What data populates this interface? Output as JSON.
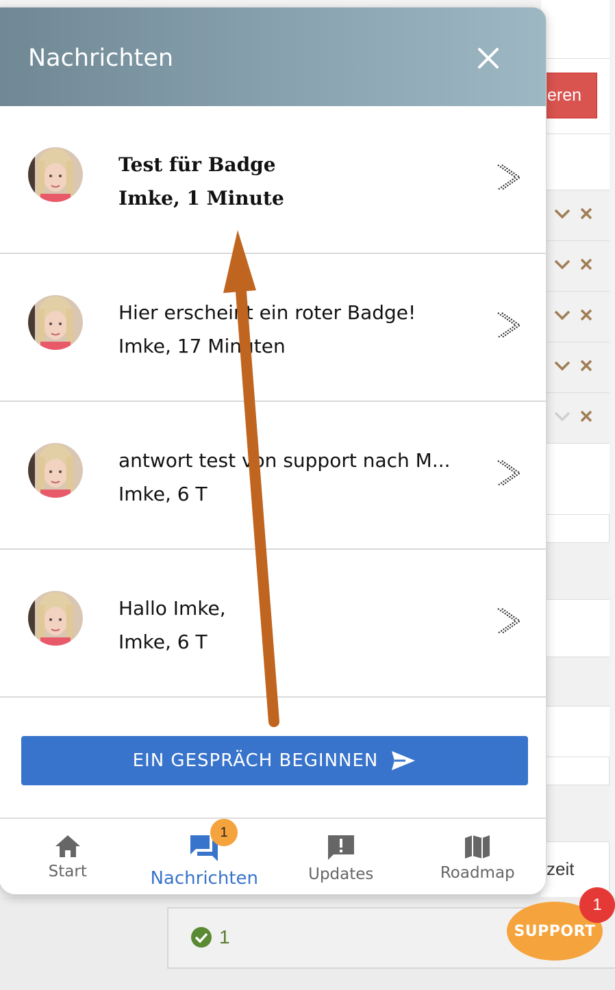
{
  "background": {
    "button_partial": "eren",
    "column_partial": "zeit",
    "status_count": "1"
  },
  "panel": {
    "title": "Nachrichten",
    "conversations": [
      {
        "title": "Test für Badge",
        "meta": "Imke, 1 Minute",
        "unread": true
      },
      {
        "title": "Hier erscheint ein roter Badge!",
        "meta": "Imke, 17 Minuten",
        "unread": false
      },
      {
        "title": "antwort test von support nach M...",
        "meta": "Imke, 6 T",
        "unread": false
      },
      {
        "title": "Hallo Imke,",
        "meta": "Imke, 6 T",
        "unread": false
      }
    ],
    "start_button": "EIN GESPRÄCH BEGINNEN"
  },
  "nav": {
    "items": [
      {
        "label": "Start",
        "icon": "home-icon"
      },
      {
        "label": "Nachrichten",
        "icon": "chat-icon",
        "badge": "1"
      },
      {
        "label": "Updates",
        "icon": "alert-message-icon"
      },
      {
        "label": "Roadmap",
        "icon": "map-icon"
      }
    ]
  },
  "support": {
    "label": "SUPPORT",
    "count": "1"
  },
  "colors": {
    "primary": "#3874cb",
    "badge_orange": "#f5a33c",
    "badge_red": "#e53935",
    "arrow": "#c0651f",
    "header_start": "#6f8894",
    "header_end": "#9db7c3"
  }
}
